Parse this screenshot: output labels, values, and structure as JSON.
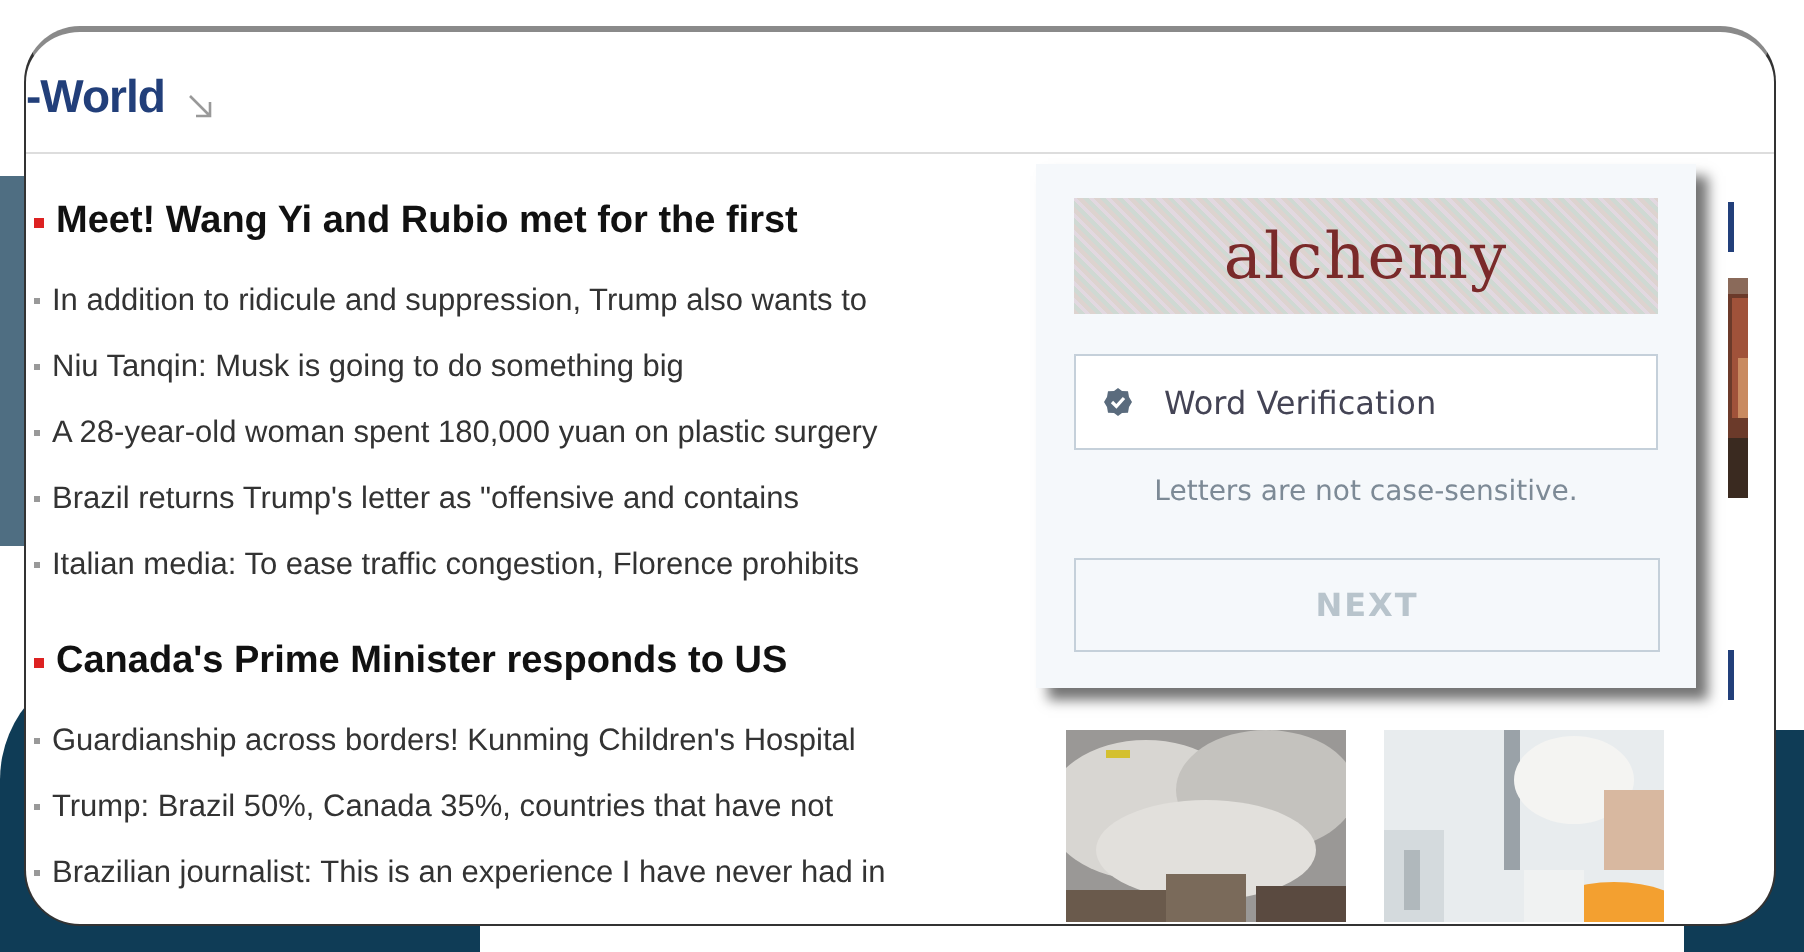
{
  "section": {
    "title": "-World"
  },
  "groups": [
    {
      "headline": "Meet! Wang Yi and Rubio met for the first",
      "items": [
        "In addition to ridicule and suppression, Trump also wants to",
        "Niu Tanqin: Musk is going to do something big",
        "A 28-year-old woman spent 180,000 yuan on plastic surgery",
        "Brazil returns Trump's letter as \"offensive and contains",
        "Italian media: To ease traffic congestion, Florence prohibits"
      ]
    },
    {
      "headline": "Canada's Prime Minister responds to US",
      "items": [
        "Guardianship across borders! Kunming Children's Hospital",
        "Trump: Brazil 50%, Canada 35%, countries that have not",
        "Brazilian journalist: This is an experience I have never had in"
      ]
    }
  ],
  "captcha": {
    "word": "alchemy",
    "placeholder": "Word Verification",
    "hint": "Letters are not case-sensitive.",
    "button": {
      "label": "NEXT",
      "disabled": true
    }
  }
}
